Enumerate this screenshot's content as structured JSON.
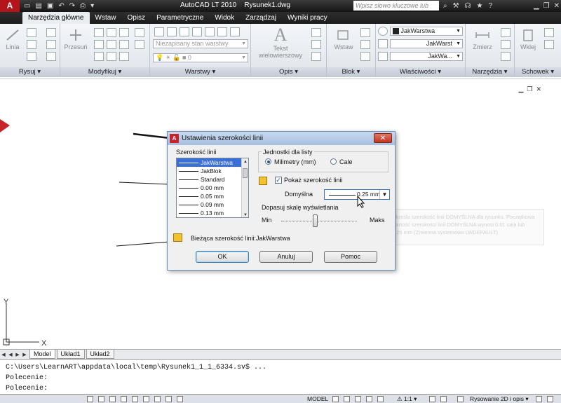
{
  "app": {
    "title": "AutoCAD LT 2010",
    "document": "Rysunek1.dwg",
    "logo": "A",
    "search_placeholder": "Wpisz słowo kluczowe lub frazę"
  },
  "tabs": [
    "Narzędzia główne",
    "Wstaw",
    "Opisz",
    "Parametryczne",
    "Widok",
    "Zarządzaj",
    "Wyniki pracy"
  ],
  "ribbon": {
    "panels": {
      "draw": "Rysuj",
      "modify": "Modyfikuj",
      "layers": "Warstwy",
      "annotation": "Opis",
      "block": "Blok",
      "properties": "Właściwości",
      "utilities": "Narzędzia",
      "clipboard": "Schowek"
    },
    "buttons": {
      "line": "Linia",
      "move": "Przesuń",
      "text1": "Tekst",
      "text2": "wielowierszowy",
      "insert": "Wstaw",
      "measure": "Zmierz",
      "paste": "Wklej"
    },
    "layer_state": "Niezapisany stan warstwy",
    "layer_current": "0",
    "prop_color": "JakWarstwa",
    "prop_linetype": "JakWarst",
    "prop_lineweight": "JakWa...",
    "colors": {
      "accent": "#3b6fd4",
      "app_red": "#b5141b"
    }
  },
  "dialog": {
    "title": "Ustawienia szerokości linii",
    "list_label": "Szerokość linii",
    "list_items": [
      "JakWarstwa",
      "JakBlok",
      "Standard",
      "0.00 mm",
      "0.05 mm",
      "0.09 mm",
      "0.13 mm"
    ],
    "units_label": "Jednostki dla listy",
    "unit_mm": "Milimetry (mm)",
    "unit_in": "Cale",
    "show_lw": "Pokaż szerokość linii",
    "default_label": "Domyślna",
    "default_value": "0.25 mm",
    "adjust_label": "Dopasuj skalę wyświetlania",
    "min": "Min",
    "max": "Maks",
    "current_label": "Bieżąca szerokość linii:",
    "current_value": "JakWarstwa",
    "ok": "OK",
    "cancel": "Anuluj",
    "help": "Pomoc"
  },
  "tooltip": {
    "text": "Określa szerokość linii DOMYŚLNA dla rysunku. Początkowa wartość szerokości linii DOMYŚLNA wynosi 0.01 cala lub 0.25 mm (Zmienna systemowa LWDEFAULT)"
  },
  "layout_tabs": [
    "Model",
    "Układ1",
    "Układ2"
  ],
  "command": {
    "line1": "C:\\Users\\LearnART\\appdata\\local\\temp\\Rysunek1_1_1_6334.sv$ ...",
    "line2": "Polecenie:",
    "line3": "Polecenie:"
  },
  "status": {
    "model": "MODEL",
    "annotation_scale": "1:1",
    "workspace": "Rysowanie 2D i opis"
  },
  "ucs": {
    "x": "X",
    "y": "Y"
  }
}
